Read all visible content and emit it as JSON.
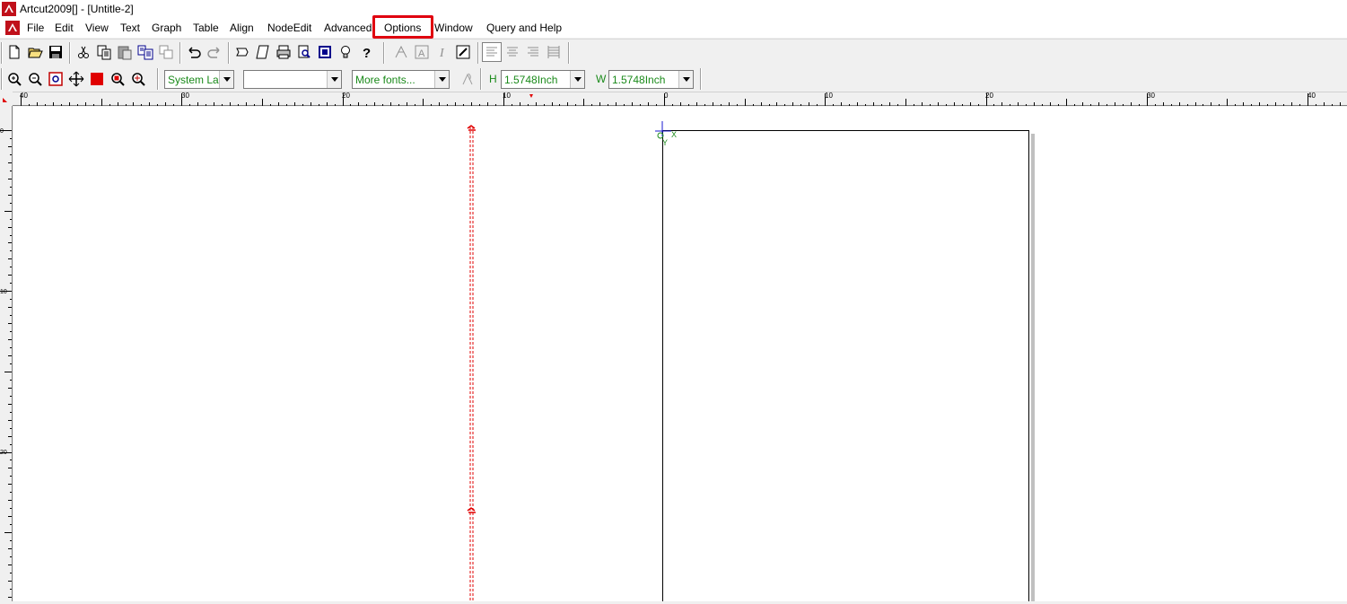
{
  "window": {
    "title": "Artcut2009[] - [Untitle-2]"
  },
  "menu": {
    "items": [
      "File",
      "Edit",
      "View",
      "Text",
      "Graph",
      "Table",
      "Align",
      "NodeEdit",
      "Advanced",
      "Options",
      "Window",
      "Query and Help"
    ],
    "highlighted": "Options"
  },
  "toolbar2": {
    "font_script": "System Lan",
    "font_name": "",
    "more_fonts": "More fonts...",
    "height_label": "H",
    "height_value": "1.5748Inch",
    "width_label": "W",
    "width_value": "1.5748Inch"
  },
  "rulers": {
    "horizontal_labels": [
      "40",
      "30",
      "20",
      "10",
      "0",
      "10",
      "20",
      "30",
      "40"
    ],
    "vertical_labels": [
      "0",
      "10",
      "20"
    ]
  },
  "canvas": {
    "origin_x_label": "X",
    "origin_y_label": "Y",
    "colors": {
      "guide": "#e00000",
      "page_border": "#000000",
      "page_shadow": "#c0c0c0",
      "axis_x": "#1a8a1a",
      "axis_y": "#1a1ad0"
    }
  },
  "icons": {
    "toolbar1": [
      "new-icon",
      "open-icon",
      "save-icon",
      "cut-icon",
      "copy-icon",
      "paste-icon",
      "paste-special-icon",
      "clone-icon",
      "undo-icon",
      "redo-icon",
      "import-icon",
      "export-icon",
      "print-icon",
      "print-preview-icon",
      "frame-icon",
      "tip-icon",
      "help-icon",
      "text-shadow-icon",
      "text-outline-icon",
      "italic-icon",
      "edit-text-icon",
      "align-left-icon",
      "align-center-icon",
      "align-right-icon",
      "justify-icon"
    ],
    "toolbar2": [
      "zoom-in-icon",
      "zoom-out-icon",
      "zoom-page-icon",
      "pan-icon",
      "fill-color-icon",
      "zoom-selection-icon",
      "zoom-all-icon",
      "text-tool-icon"
    ]
  }
}
